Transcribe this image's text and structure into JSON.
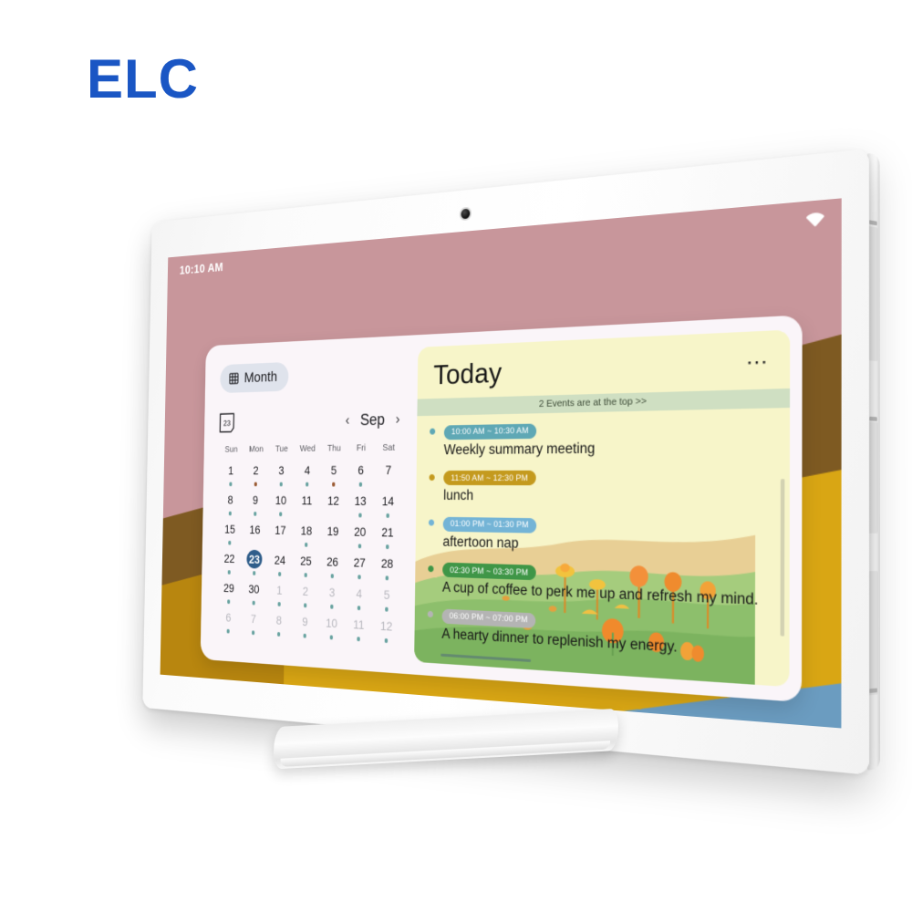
{
  "brand": {
    "name": "ELC",
    "color": "#1a56c4"
  },
  "device": {
    "type": "tablet",
    "camera_icon": "camera-dot",
    "side_ports_count": 3
  },
  "statusbar": {
    "time": "10:10 AM",
    "wifi_icon": "wifi-icon"
  },
  "calendar": {
    "view_button": {
      "label": "Month",
      "icon": "grid-icon"
    },
    "date_badge": {
      "icon": "calendar-date-icon",
      "day": "23"
    },
    "nav": {
      "prev": "‹",
      "month": "Sep",
      "next": "›"
    },
    "weekdays": [
      "Sun",
      "Mon",
      "Tue",
      "Wed",
      "Thu",
      "Fri",
      "Sat"
    ],
    "selected_day": 23,
    "days": [
      {
        "n": "1",
        "muted": false,
        "dot": "teal"
      },
      {
        "n": "2",
        "muted": false,
        "dot": "brown"
      },
      {
        "n": "3",
        "muted": false,
        "dot": "teal"
      },
      {
        "n": "4",
        "muted": false,
        "dot": "teal"
      },
      {
        "n": "5",
        "muted": false,
        "dot": "brown"
      },
      {
        "n": "6",
        "muted": false,
        "dot": "teal"
      },
      {
        "n": "7",
        "muted": false,
        "dot": "none"
      },
      {
        "n": "8",
        "muted": false,
        "dot": "teal"
      },
      {
        "n": "9",
        "muted": false,
        "dot": "teal"
      },
      {
        "n": "10",
        "muted": false,
        "dot": "teal"
      },
      {
        "n": "11",
        "muted": false,
        "dot": "none"
      },
      {
        "n": "12",
        "muted": false,
        "dot": "none"
      },
      {
        "n": "13",
        "muted": false,
        "dot": "teal"
      },
      {
        "n": "14",
        "muted": false,
        "dot": "teal"
      },
      {
        "n": "15",
        "muted": false,
        "dot": "teal"
      },
      {
        "n": "16",
        "muted": false,
        "dot": "none"
      },
      {
        "n": "17",
        "muted": false,
        "dot": "none"
      },
      {
        "n": "18",
        "muted": false,
        "dot": "teal"
      },
      {
        "n": "19",
        "muted": false,
        "dot": "none"
      },
      {
        "n": "20",
        "muted": false,
        "dot": "teal"
      },
      {
        "n": "21",
        "muted": false,
        "dot": "teal"
      },
      {
        "n": "22",
        "muted": false,
        "dot": "teal"
      },
      {
        "n": "23",
        "muted": false,
        "dot": "teal",
        "today": true
      },
      {
        "n": "24",
        "muted": false,
        "dot": "teal"
      },
      {
        "n": "25",
        "muted": false,
        "dot": "teal"
      },
      {
        "n": "26",
        "muted": false,
        "dot": "teal"
      },
      {
        "n": "27",
        "muted": false,
        "dot": "teal"
      },
      {
        "n": "28",
        "muted": false,
        "dot": "teal"
      },
      {
        "n": "29",
        "muted": false,
        "dot": "teal"
      },
      {
        "n": "30",
        "muted": false,
        "dot": "teal"
      },
      {
        "n": "1",
        "muted": true,
        "dot": "teal"
      },
      {
        "n": "2",
        "muted": true,
        "dot": "teal"
      },
      {
        "n": "3",
        "muted": true,
        "dot": "teal"
      },
      {
        "n": "4",
        "muted": true,
        "dot": "teal"
      },
      {
        "n": "5",
        "muted": true,
        "dot": "teal"
      },
      {
        "n": "6",
        "muted": true,
        "dot": "teal"
      },
      {
        "n": "7",
        "muted": true,
        "dot": "teal"
      },
      {
        "n": "8",
        "muted": true,
        "dot": "teal"
      },
      {
        "n": "9",
        "muted": true,
        "dot": "teal"
      },
      {
        "n": "10",
        "muted": true,
        "dot": "teal"
      },
      {
        "n": "11",
        "muted": true,
        "dot": "teal"
      },
      {
        "n": "12",
        "muted": true,
        "dot": "teal"
      }
    ]
  },
  "today": {
    "title": "Today",
    "menu_icon": "more-options-icon",
    "banner": "2 Events are at the top >>",
    "events": [
      {
        "time": "10:00 AM ~ 10:30 AM",
        "title": "Weekly summary meeting",
        "color": "#5fa8b5"
      },
      {
        "time": "11:50 AM ~ 12:30 PM",
        "title": "lunch",
        "color": "#c49a1e"
      },
      {
        "time": "01:00 PM ~ 01:30 PM",
        "title": "aftertoon nap",
        "color": "#74b4d6"
      },
      {
        "time": "02:30 PM ~ 03:30 PM",
        "title": "A cup of coffee to perk me up and refresh my mind.",
        "color": "#3f9647"
      },
      {
        "time": "06:00 PM ~ 07:00 PM",
        "title": "A hearty dinner to replenish my energy.",
        "color": "#b4b4b4"
      }
    ]
  },
  "wallpaper": {
    "rose": "#c8969b",
    "blue": "#6b9cc0",
    "brown": "#7e5a22",
    "gold": "#d9a614"
  }
}
